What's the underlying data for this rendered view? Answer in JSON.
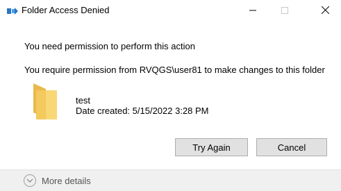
{
  "window": {
    "title": "Folder Access Denied",
    "controls": {
      "minimize_icon": "minimize-icon",
      "maximize_icon": "maximize-icon",
      "close_icon": "close-icon"
    }
  },
  "message": {
    "headline": "You need permission to perform this action",
    "detail": "You require permission from RVQGS\\user81 to make changes to this folder"
  },
  "item": {
    "icon": "folder-icon",
    "name": "test",
    "date_created": "Date created: 5/15/2022 3:28 PM"
  },
  "buttons": {
    "try_again": "Try Again",
    "cancel": "Cancel"
  },
  "footer": {
    "more_details": "More details",
    "icon": "chevron-down-icon"
  },
  "colors": {
    "folder_yellow": "#f8d775",
    "folder_shadow": "#e8b94a",
    "button_face": "#e1e1e1",
    "footer_bg": "#f0f0f0"
  }
}
